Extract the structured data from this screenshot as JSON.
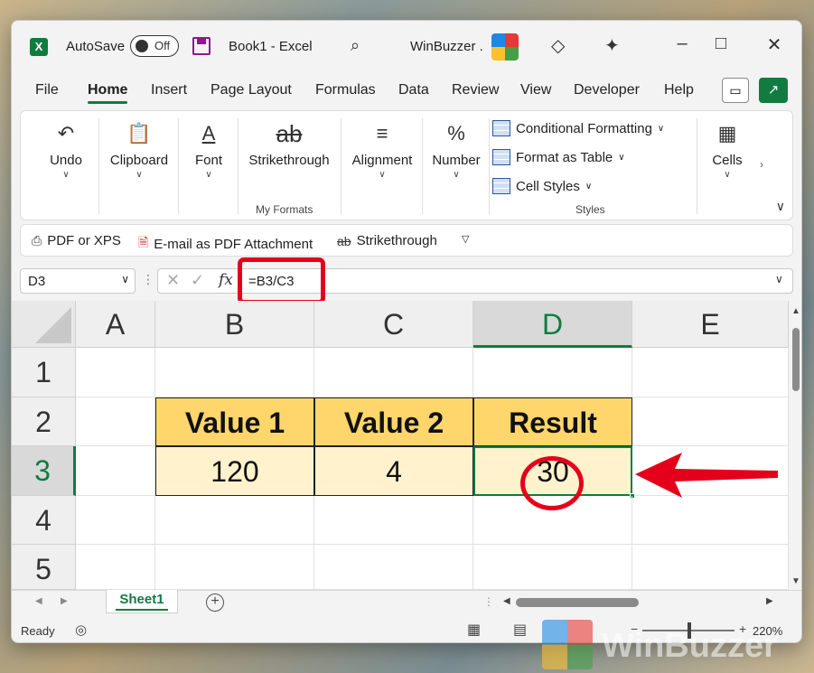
{
  "titlebar": {
    "app_icon": "excel-logo-icon",
    "autosave_label": "AutoSave",
    "autosave_state": "Off",
    "doc_title": "Book1  -  Excel",
    "account_name": "WinBuzzer ."
  },
  "menu": {
    "items": [
      "File",
      "Home",
      "Insert",
      "Page Layout",
      "Formulas",
      "Data",
      "Review",
      "View",
      "Developer",
      "Help"
    ],
    "active": "Home"
  },
  "ribbon": {
    "undo": "Undo",
    "clipboard": "Clipboard",
    "font": "Font",
    "strikethrough": "Strikethrough",
    "strikethrough_icon_text": "ab",
    "my_formats": "My Formats",
    "alignment": "Alignment",
    "number": "Number",
    "number_icon": "%",
    "conditional_formatting": "Conditional Formatting",
    "format_as_table": "Format as Table",
    "cell_styles": "Cell Styles",
    "styles_group": "Styles",
    "cells": "Cells"
  },
  "qat": {
    "pdf_xps": "PDF or XPS",
    "email_pdf": "E-mail as PDF Attachment",
    "strikethrough": "Strikethrough",
    "strike_icon": "ab"
  },
  "formula_bar": {
    "name_box": "D3",
    "formula": "=B3/C3",
    "fx": "fx"
  },
  "grid": {
    "columns": [
      "A",
      "B",
      "C",
      "D",
      "E"
    ],
    "rows": [
      "1",
      "2",
      "3",
      "4",
      "5"
    ],
    "headers": {
      "B2": "Value 1",
      "C2": "Value 2",
      "D2": "Result"
    },
    "values": {
      "B3": "120",
      "C3": "4",
      "D3": "30"
    },
    "selected_cell": "D3"
  },
  "sheets": {
    "tabs": [
      "Sheet1"
    ],
    "active": "Sheet1",
    "add_symbol": "+"
  },
  "status": {
    "ready": "Ready",
    "zoom_minus": "−",
    "zoom_plus": "+",
    "zoom": "220%"
  },
  "watermark": {
    "text": "WinBuzzer"
  },
  "colors": {
    "excel_green": "#107c41",
    "header_fill": "#ffd66b",
    "value_fill": "#fff2cc",
    "annotation_red": "#e4001b"
  }
}
